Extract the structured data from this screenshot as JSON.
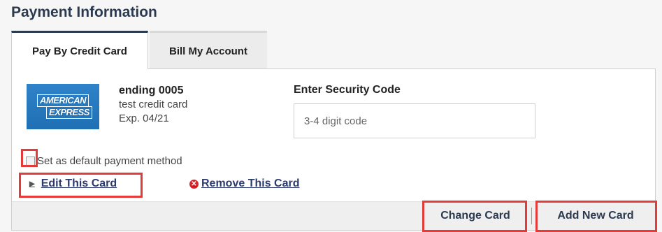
{
  "page": {
    "title": "Payment Information"
  },
  "tabs": [
    {
      "label": "Pay By Credit Card",
      "active": true
    },
    {
      "label": "Bill My Account",
      "active": false
    }
  ],
  "card": {
    "brand_line1": "AMERICAN",
    "brand_line2": "EXPRESS",
    "ending": "ending 0005",
    "nickname": "test credit card",
    "expiration": "Exp. 04/21"
  },
  "security": {
    "label": "Enter Security Code",
    "placeholder": "3-4 digit code",
    "value": ""
  },
  "default_payment": {
    "label": "Set as default payment method",
    "checked": false
  },
  "links": {
    "edit": "Edit This Card",
    "remove": "Remove This Card"
  },
  "footer": {
    "change_card": "Change Card",
    "add_new_card": "Add New Card"
  },
  "colors": {
    "brand_navy": "#2b3a4f",
    "link": "#2b3a6f",
    "amex_blue": "#2f83c9",
    "highlight": "#e53a3a",
    "remove_red": "#d8232a"
  },
  "icons": {
    "edit_caret": "caret-right-icon",
    "remove": "remove-x-circle-icon"
  }
}
